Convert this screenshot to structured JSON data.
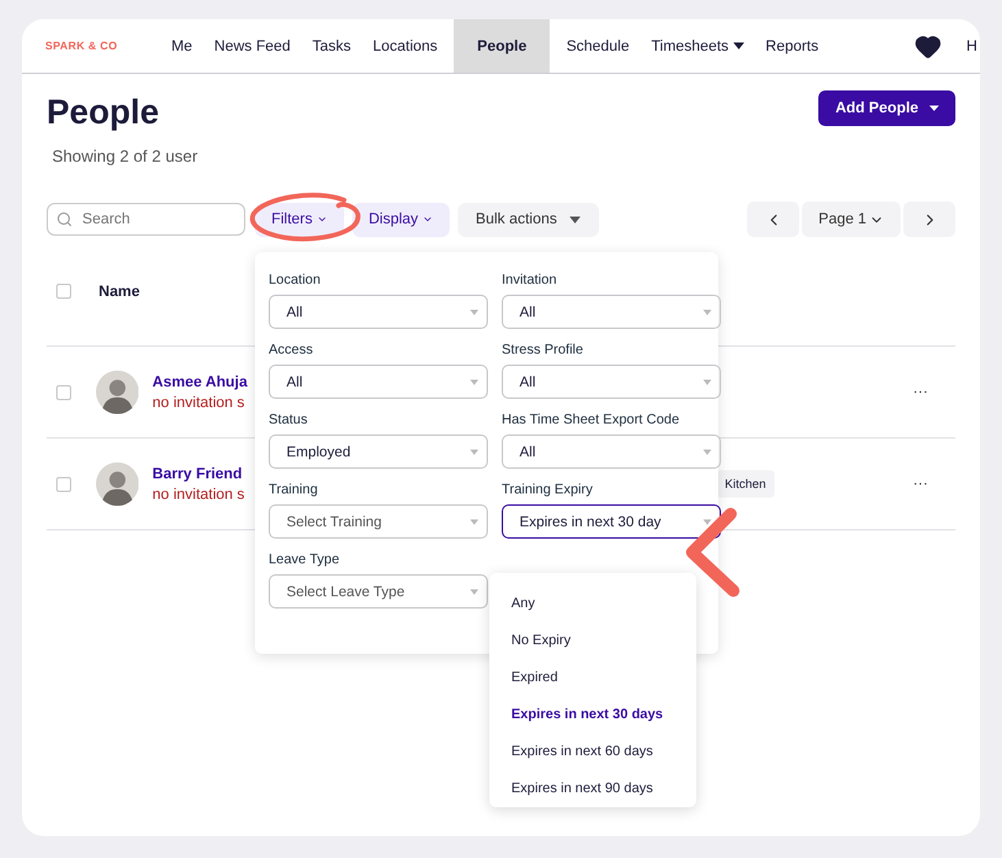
{
  "nav": {
    "logo": "SPARK & CO",
    "items": [
      {
        "label": "Me",
        "selected": false,
        "has_caret": false
      },
      {
        "label": "News Feed",
        "selected": false,
        "has_caret": false
      },
      {
        "label": "Tasks",
        "selected": false,
        "has_caret": false
      },
      {
        "label": "Locations",
        "selected": false,
        "has_caret": false
      },
      {
        "label": "People",
        "selected": true,
        "has_caret": false
      },
      {
        "label": "Schedule",
        "selected": false,
        "has_caret": false
      },
      {
        "label": "Timesheets",
        "selected": false,
        "has_caret": true
      },
      {
        "label": "Reports",
        "selected": false,
        "has_caret": false
      }
    ],
    "user_initial": "H"
  },
  "page": {
    "title": "People",
    "subtitle": "Showing 2 of 2 user",
    "add_button": "Add People"
  },
  "toolbar": {
    "search_placeholder": "Search",
    "filters": "Filters",
    "display": "Display",
    "bulk_actions": "Bulk actions",
    "page": "Page 1"
  },
  "table": {
    "header_checked": false,
    "columns": [
      "Name"
    ],
    "rows": [
      {
        "name": "Asmee Ahuja",
        "status": "no invitation s",
        "tags": [],
        "checked": false,
        "menu": "···"
      },
      {
        "name": "Barry Friend",
        "status": "no invitation s",
        "tags": [
          "Kitchen"
        ],
        "checked": false,
        "menu": "···"
      }
    ]
  },
  "filter_panel": {
    "fields": [
      {
        "label": "Location",
        "value": "All",
        "focused": false
      },
      {
        "label": "Invitation",
        "value": "All",
        "focused": false
      },
      {
        "label": "Access",
        "value": "All",
        "focused": false
      },
      {
        "label": "Stress Profile",
        "value": "All",
        "focused": false
      },
      {
        "label": "Status",
        "value": "Employed",
        "focused": false
      },
      {
        "label": "Has Time Sheet Export Code",
        "value": "All",
        "focused": false
      },
      {
        "label": "Training",
        "placeholder": "Select Training",
        "focused": false
      },
      {
        "label": "Training Expiry",
        "value": "Expires in next 30 day",
        "focused": true
      },
      {
        "label": "Leave Type",
        "placeholder": "Select Leave Type",
        "focused": false
      }
    ]
  },
  "expiry_menu": {
    "options": [
      {
        "label": "Any",
        "selected": false
      },
      {
        "label": "No Expiry",
        "selected": false
      },
      {
        "label": "Expired",
        "selected": false
      },
      {
        "label": "Expires in next 30 days",
        "selected": true
      },
      {
        "label": "Expires in next 60 days",
        "selected": false
      },
      {
        "label": "Expires in next 90 days",
        "selected": false
      }
    ]
  }
}
